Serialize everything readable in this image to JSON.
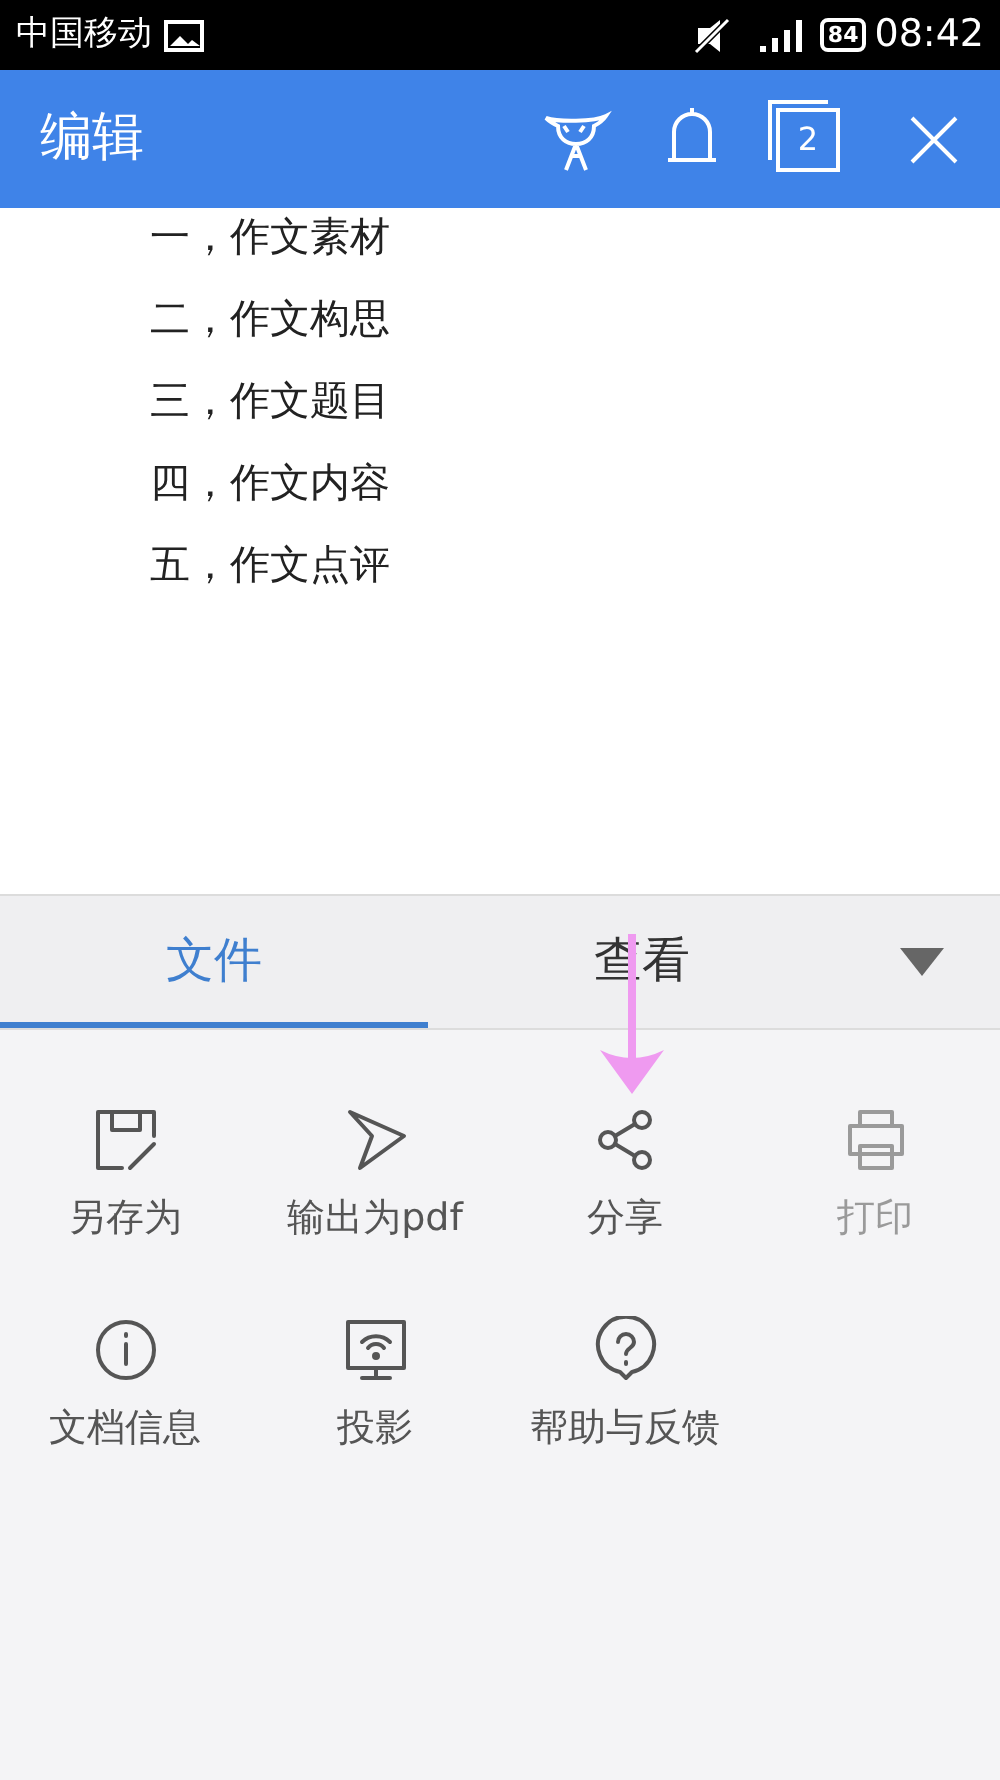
{
  "status_bar": {
    "carrier": "中国移动",
    "battery": "84",
    "time": "08:42"
  },
  "header": {
    "title": "编辑",
    "window_count": "2"
  },
  "document": {
    "lines": [
      "一，作文素材",
      "二，作文构思",
      "三，作文题目",
      "四，作文内容",
      "五，作文点评"
    ]
  },
  "tabs": [
    {
      "label": "文件",
      "selected": true
    },
    {
      "label": "查看",
      "selected": false
    }
  ],
  "actions": [
    {
      "label": "另存为",
      "kind": "save",
      "disabled": false
    },
    {
      "label": "输出为pdf",
      "kind": "export",
      "disabled": false
    },
    {
      "label": "分享",
      "kind": "share",
      "disabled": false
    },
    {
      "label": "打印",
      "kind": "print",
      "disabled": true
    },
    {
      "label": "文档信息",
      "kind": "info",
      "disabled": false
    },
    {
      "label": "投影",
      "kind": "cast",
      "disabled": false
    },
    {
      "label": "帮助与反馈",
      "kind": "help",
      "disabled": false
    }
  ]
}
